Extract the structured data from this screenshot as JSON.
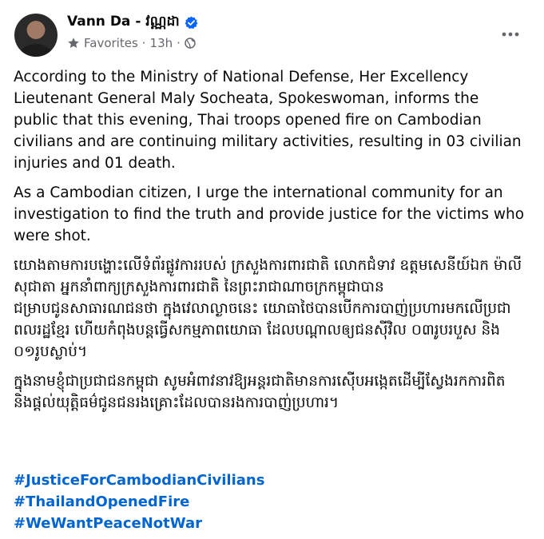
{
  "post": {
    "author": "Vann Da - វណ្ណដា",
    "audience": "Favorites",
    "time": "13h",
    "separator": "·",
    "paragraphs": [
      "According to the Ministry of National Defense, Her Excellency Lieutenant General Maly Socheata, Spokeswoman, informs the public that this evening, Thai troops opened fire on Cambodian civilians and are continuing military activities, resulting in 03 civilian injuries and 01 death.",
      "As a Cambodian citizen, I urge the international community for an investigation to find the truth and provide justice for the victims who were shot.",
      "យោងតាមការបង្ហោះលើទំព័រផ្លូវការរបស់ ក្រសួងការពារជាតិ លោកជំទាវ ឧត្តមសេនីយ៍ឯក ម៉ាលី សុជាតា អ្នកនាំពាក្យក្រសួងការពារជាតិ នៃព្រះរាជាណាចក្រកម្ពុជាបានជម្រាបជូនសាធារណជនថា ក្នុងវេលាល្ងាចនេះ យោធាថៃបានបើកការបាញ់ប្រហារមកលើប្រជាពលរដ្ឋខ្មែរ ហើយកំពុងបន្តធ្វើសកម្មភាពយោធា ដែលបណ្ដាលឲ្យជនស៊ីវិល ០៣រូបរបួស និង ០១រូបស្លាប់។",
      "ក្នុងនាមខ្ញុំជាប្រជាជនកម្ពុជា សូមអំពាវនាវឱ្យអន្តរជាតិមានការស៊ើបអង្កេតដើម្បីស្វែងរកការពិត និងផ្ដល់យុត្តិធម៌ជូនជនរងគ្រោះដែលបានរងការបាញ់ប្រហារ។"
    ],
    "hashtags": [
      "#JusticeForCambodianCivilians",
      "#ThailandOpenedFire",
      "#WeWantPeaceNotWar"
    ]
  },
  "colors": {
    "verified": "#0866ff",
    "hashtag": "#0064d1",
    "meta": "#65686c"
  },
  "icons": {
    "audience": "star-icon",
    "privacy": "globe-icon",
    "more": "more-horizontal-icon"
  }
}
